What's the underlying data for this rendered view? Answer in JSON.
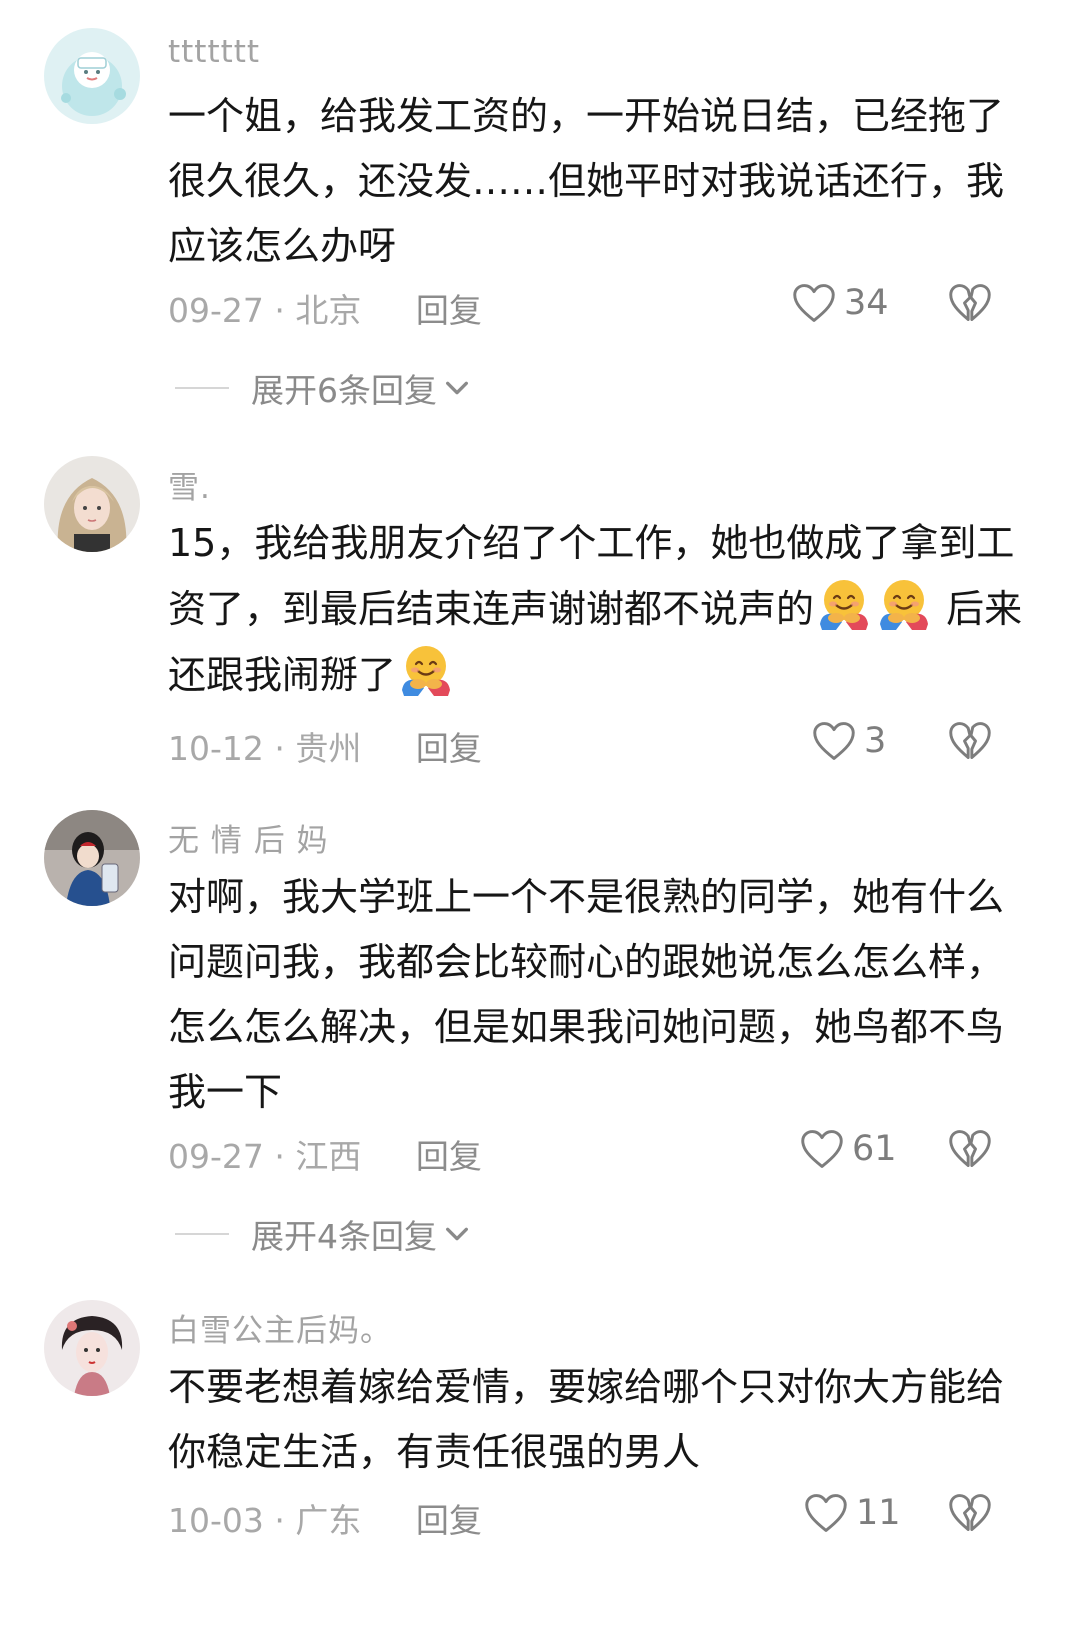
{
  "comments": [
    {
      "user": "ttttttt",
      "text": "一个姐，给我发工资的，一开始说日结，已经拖了很久很久，还没发……但她平时对我说话还行，我应该怎么办呀",
      "date": "09-27",
      "location": "北京",
      "reply": "回复",
      "likes": "34",
      "expand": "展开6条回复"
    },
    {
      "user": "雪.",
      "text_a": "15，我给我朋友介绍了个工作，她也做成了拿到工资了，到最后结束连声谢谢都不说声的",
      "text_b": "后来还跟我闹掰了",
      "date": "10-12",
      "location": "贵州",
      "reply": "回复",
      "likes": "3"
    },
    {
      "user": "无 情 后 妈",
      "text": "对啊，我大学班上一个不是很熟的同学，她有什么问题问我，我都会比较耐心的跟她说怎么怎么样，怎么怎么解决，但是如果我问她问题，她鸟都不鸟我一下",
      "date": "09-27",
      "location": "江西",
      "reply": "回复",
      "likes": "61",
      "expand": "展开4条回复"
    },
    {
      "user": "白雪公主后妈。",
      "text": "不要老想着嫁给爱情，要嫁给哪个只对你大方能给你稳定生活，有责任很强的男人",
      "date": "10-03",
      "location": "广东",
      "reply": "回复",
      "likes": "11"
    }
  ],
  "separator": "·",
  "icons": {
    "like": "heart-outline-icon",
    "dislike": "broken-heart-icon",
    "expand": "chevron-down-icon",
    "emoji": "hugging-face-emoji"
  },
  "colors": {
    "text": "#161616",
    "meta": "#a8a8a8",
    "icon": "#7d7d7d"
  }
}
